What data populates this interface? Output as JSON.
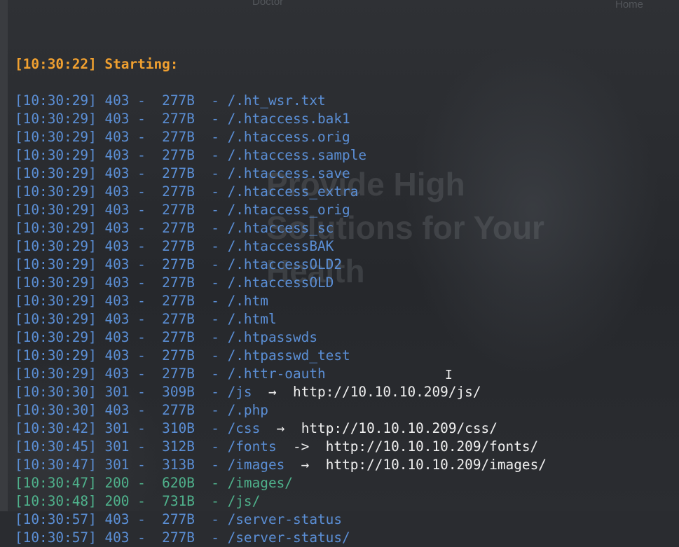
{
  "background": {
    "nav_left": "Doctor",
    "nav_right": "Home",
    "hero_lines": [
      "Provide High",
      "Solutions for Your",
      "Health"
    ]
  },
  "colors": {
    "starting": "#f0a030",
    "status_403": "#5b8fd6",
    "status_301": "#5b8fd6",
    "status_200": "#4fb28c",
    "redirect_text": "#f0f0f0",
    "background": "#2a2c30"
  },
  "terminal": {
    "starting_line": "[10:30:22] Starting:",
    "entries": [
      {
        "time": "[10:30:29]",
        "status": "403",
        "size": "277B",
        "path": "/.ht_wsr.txt",
        "arrow": "",
        "redirect": ""
      },
      {
        "time": "[10:30:29]",
        "status": "403",
        "size": "277B",
        "path": "/.htaccess.bak1",
        "arrow": "",
        "redirect": ""
      },
      {
        "time": "[10:30:29]",
        "status": "403",
        "size": "277B",
        "path": "/.htaccess.orig",
        "arrow": "",
        "redirect": ""
      },
      {
        "time": "[10:30:29]",
        "status": "403",
        "size": "277B",
        "path": "/.htaccess.sample",
        "arrow": "",
        "redirect": ""
      },
      {
        "time": "[10:30:29]",
        "status": "403",
        "size": "277B",
        "path": "/.htaccess.save",
        "arrow": "",
        "redirect": ""
      },
      {
        "time": "[10:30:29]",
        "status": "403",
        "size": "277B",
        "path": "/.htaccess_extra",
        "arrow": "",
        "redirect": ""
      },
      {
        "time": "[10:30:29]",
        "status": "403",
        "size": "277B",
        "path": "/.htaccess_orig",
        "arrow": "",
        "redirect": ""
      },
      {
        "time": "[10:30:29]",
        "status": "403",
        "size": "277B",
        "path": "/.htaccess_sc",
        "arrow": "",
        "redirect": ""
      },
      {
        "time": "[10:30:29]",
        "status": "403",
        "size": "277B",
        "path": "/.htaccessBAK",
        "arrow": "",
        "redirect": ""
      },
      {
        "time": "[10:30:29]",
        "status": "403",
        "size": "277B",
        "path": "/.htaccessOLD2",
        "arrow": "",
        "redirect": ""
      },
      {
        "time": "[10:30:29]",
        "status": "403",
        "size": "277B",
        "path": "/.htaccessOLD",
        "arrow": "",
        "redirect": ""
      },
      {
        "time": "[10:30:29]",
        "status": "403",
        "size": "277B",
        "path": "/.htm",
        "arrow": "",
        "redirect": ""
      },
      {
        "time": "[10:30:29]",
        "status": "403",
        "size": "277B",
        "path": "/.html",
        "arrow": "",
        "redirect": ""
      },
      {
        "time": "[10:30:29]",
        "status": "403",
        "size": "277B",
        "path": "/.htpasswds",
        "arrow": "",
        "redirect": ""
      },
      {
        "time": "[10:30:29]",
        "status": "403",
        "size": "277B",
        "path": "/.htpasswd_test",
        "arrow": "",
        "redirect": ""
      },
      {
        "time": "[10:30:29]",
        "status": "403",
        "size": "277B",
        "path": "/.httr-oauth",
        "arrow": "",
        "redirect": ""
      },
      {
        "time": "[10:30:30]",
        "status": "301",
        "size": "309B",
        "path": "/js",
        "arrow": "→",
        "redirect": "http://10.10.10.209/js/"
      },
      {
        "time": "[10:30:30]",
        "status": "403",
        "size": "277B",
        "path": "/.php",
        "arrow": "",
        "redirect": ""
      },
      {
        "time": "[10:30:42]",
        "status": "301",
        "size": "310B",
        "path": "/css",
        "arrow": "→",
        "redirect": "http://10.10.10.209/css/"
      },
      {
        "time": "[10:30:45]",
        "status": "301",
        "size": "312B",
        "path": "/fonts",
        "arrow": "->",
        "redirect": "http://10.10.10.209/fonts/"
      },
      {
        "time": "[10:30:47]",
        "status": "301",
        "size": "313B",
        "path": "/images",
        "arrow": "→",
        "redirect": "http://10.10.10.209/images/"
      },
      {
        "time": "[10:30:47]",
        "status": "200",
        "size": "620B",
        "path": "/images/",
        "arrow": "",
        "redirect": ""
      },
      {
        "time": "[10:30:48]",
        "status": "200",
        "size": "731B",
        "path": "/js/",
        "arrow": "",
        "redirect": ""
      },
      {
        "time": "[10:30:57]",
        "status": "403",
        "size": "277B",
        "path": "/server-status",
        "arrow": "",
        "redirect": ""
      },
      {
        "time": "[10:30:57]",
        "status": "403",
        "size": "277B",
        "path": "/server-status/",
        "arrow": "",
        "redirect": ""
      }
    ],
    "cursor_icon": "text-cursor-icon"
  }
}
